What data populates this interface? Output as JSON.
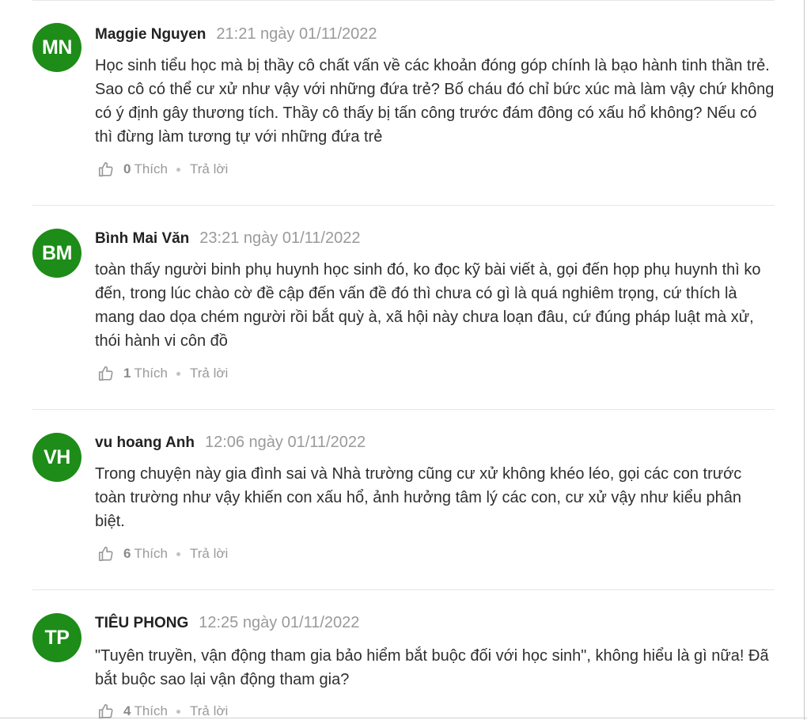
{
  "comments": [
    {
      "initials": "MN",
      "author": "Maggie Nguyen",
      "time": "21:21 ngày 01/11/2022",
      "text": "Học sinh tiểu học mà bị thầy cô chất vấn về các khoản đóng góp chính là bạo hành tinh thần trẻ. Sao cô có thể cư xử như vậy với những đứa trẻ? Bố cháu đó chỉ bức xúc mà làm vậy chứ không có ý định gây thương tích. Thầy cô thấy bị tấn công trước đám đông có xấu hổ không? Nếu có thì đừng làm tương tự với những đứa trẻ",
      "likes": "0",
      "like_label": "Thích",
      "reply_label": "Trả lời"
    },
    {
      "initials": "BM",
      "author": "Bình Mai Văn",
      "time": "23:21 ngày 01/11/2022",
      "text": "toàn thấy người binh phụ huynh học sinh đó, ko đọc kỹ bài viết à, gọi đến họp phụ huynh thì ko đến, trong lúc chào cờ đề cập đến vấn đề đó thì chưa có gì là quá nghiêm trọng, cứ thích là mang dao dọa chém người rồi bắt quỳ à, xã hội này chưa loạn đâu, cứ đúng pháp luật mà xử, thói hành vi côn đồ",
      "likes": "1",
      "like_label": "Thích",
      "reply_label": "Trả lời"
    },
    {
      "initials": "VH",
      "author": "vu hoang Anh",
      "time": "12:06 ngày 01/11/2022",
      "text": "Trong chuyện này gia đình sai và Nhà trường cũng cư xử không khéo léo, gọi các con trước toàn trường như vậy khiến con xấu hổ, ảnh hưởng tâm lý các con, cư xử vậy như kiểu phân biệt.",
      "likes": "6",
      "like_label": "Thích",
      "reply_label": "Trả lời"
    },
    {
      "initials": "TP",
      "author": "TIÊU PHONG",
      "time": "12:25 ngày 01/11/2022",
      "text": "\"Tuyên truyền, vận động tham gia bảo hiểm bắt buộc đối với học sinh\", không hiểu là gì nữa! Đã bắt buộc sao lại vận động tham gia?",
      "likes": "4",
      "like_label": "Thích",
      "reply_label": "Trả lời"
    }
  ],
  "colors": {
    "avatar_bg": "#1e8c18",
    "author": "#222222",
    "meta": "#9a9a9a",
    "text": "#2f2f2f"
  },
  "icons": {
    "like": "thumbs-up-icon"
  }
}
